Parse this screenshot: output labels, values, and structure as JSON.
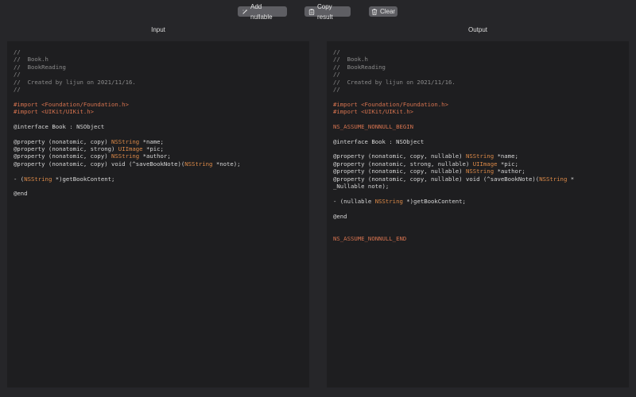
{
  "toolbar": {
    "add_nullable": "Add nullable",
    "copy_result": "Copy result",
    "clear": "Clear"
  },
  "panes": {
    "input_title": "Input",
    "output_title": "Output"
  },
  "colors": {
    "background": "#262629",
    "pane_background": "#1e1e20",
    "comment": "#8b8b8b",
    "preprocessor": "#d6734f",
    "type": "#dd8a48",
    "button": "#5e5e63"
  },
  "icons": {
    "add_nullable": "magic-wand-icon",
    "copy_result": "clipboard-icon",
    "clear": "trash-icon"
  },
  "input_code": [
    [
      {
        "t": "//",
        "c": "comment"
      }
    ],
    [
      {
        "t": "//  Book.h",
        "c": "comment"
      }
    ],
    [
      {
        "t": "//  BookReading",
        "c": "comment"
      }
    ],
    [
      {
        "t": "//",
        "c": "comment"
      }
    ],
    [
      {
        "t": "//  Created by lijun on 2021/11/16.",
        "c": "comment"
      }
    ],
    [
      {
        "t": "//",
        "c": "comment"
      }
    ],
    [],
    [
      {
        "t": "#import <Foundation/Foundation.h>",
        "c": "pre"
      }
    ],
    [
      {
        "t": "#import <UIKit/UIKit.h>",
        "c": "pre"
      }
    ],
    [],
    [
      {
        "t": "@interface Book : NSObject",
        "c": "kw"
      }
    ],
    [],
    [
      {
        "t": "@property (nonatomic, copy) ",
        "c": "kw"
      },
      {
        "t": "NSString",
        "c": "type"
      },
      {
        "t": " *name;",
        "c": "kw"
      }
    ],
    [
      {
        "t": "@property (nonatomic, strong) ",
        "c": "kw"
      },
      {
        "t": "UIImage",
        "c": "type"
      },
      {
        "t": " *pic;",
        "c": "kw"
      }
    ],
    [
      {
        "t": "@property (nonatomic, copy) ",
        "c": "kw"
      },
      {
        "t": "NSString",
        "c": "type"
      },
      {
        "t": " *author;",
        "c": "kw"
      }
    ],
    [
      {
        "t": "@property (nonatomic, copy) void (^saveBookNote)(",
        "c": "kw"
      },
      {
        "t": "NSString",
        "c": "type"
      },
      {
        "t": " *note);",
        "c": "kw"
      }
    ],
    [],
    [
      {
        "t": "- (",
        "c": "kw"
      },
      {
        "t": "NSString",
        "c": "type"
      },
      {
        "t": " *)getBookContent;",
        "c": "kw"
      }
    ],
    [],
    [
      {
        "t": "@end",
        "c": "kw"
      }
    ]
  ],
  "output_code": [
    [
      {
        "t": "//",
        "c": "comment"
      }
    ],
    [
      {
        "t": "//  Book.h",
        "c": "comment"
      }
    ],
    [
      {
        "t": "//  BookReading",
        "c": "comment"
      }
    ],
    [
      {
        "t": "//",
        "c": "comment"
      }
    ],
    [
      {
        "t": "//  Created by lijun on 2021/11/16.",
        "c": "comment"
      }
    ],
    [
      {
        "t": "//",
        "c": "comment"
      }
    ],
    [],
    [
      {
        "t": "#import <Foundation/Foundation.h>",
        "c": "pre"
      }
    ],
    [
      {
        "t": "#import <UIKit/UIKit.h>",
        "c": "pre"
      }
    ],
    [],
    [
      {
        "t": "NS_ASSUME_NONNULL_BEGIN",
        "c": "macro"
      }
    ],
    [],
    [
      {
        "t": "@interface Book : NSObject",
        "c": "kw"
      }
    ],
    [],
    [
      {
        "t": "@property (nonatomic, copy, nullable) ",
        "c": "kw"
      },
      {
        "t": "NSString",
        "c": "type"
      },
      {
        "t": " *name;",
        "c": "kw"
      }
    ],
    [
      {
        "t": "@property (nonatomic, strong, nullable) ",
        "c": "kw"
      },
      {
        "t": "UIImage",
        "c": "type"
      },
      {
        "t": " *pic;",
        "c": "kw"
      }
    ],
    [
      {
        "t": "@property (nonatomic, copy, nullable) ",
        "c": "kw"
      },
      {
        "t": "NSString",
        "c": "type"
      },
      {
        "t": " *author;",
        "c": "kw"
      }
    ],
    [
      {
        "t": "@property (nonatomic, copy, nullable) void (^saveBookNote)(",
        "c": "kw"
      },
      {
        "t": "NSString",
        "c": "type"
      },
      {
        "t": " *",
        "c": "kw"
      }
    ],
    [
      {
        "t": "_Nullable note);",
        "c": "kw"
      }
    ],
    [],
    [
      {
        "t": "- (nullable ",
        "c": "kw"
      },
      {
        "t": "NSString",
        "c": "type"
      },
      {
        "t": " *)getBookContent;",
        "c": "kw"
      }
    ],
    [],
    [
      {
        "t": "@end",
        "c": "kw"
      }
    ],
    [],
    [],
    [
      {
        "t": "NS_ASSUME_NONNULL_END",
        "c": "macro"
      }
    ]
  ]
}
